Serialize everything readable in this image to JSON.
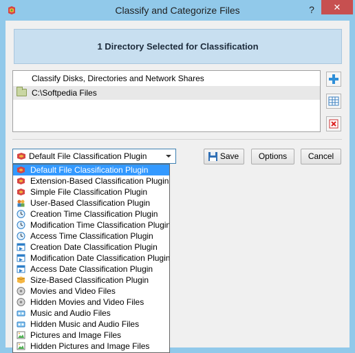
{
  "window": {
    "title": "Classify and Categorize Files",
    "help_label": "?",
    "close_label": "✕"
  },
  "header_panel": {
    "text": "1 Directory Selected for Classification"
  },
  "directory_list": {
    "header": "Classify Disks, Directories and Network Shares",
    "items": [
      {
        "label": "C:\\Softpedia Files",
        "icon": "folder-icon"
      }
    ]
  },
  "side_buttons": [
    {
      "name": "add-directory-button",
      "icon": "plus-icon"
    },
    {
      "name": "select-directory-button",
      "icon": "grid-icon"
    },
    {
      "name": "remove-directory-button",
      "icon": "remove-icon"
    }
  ],
  "plugin_select": {
    "selected": "Default File Classification Plugin",
    "options": [
      {
        "label": "Default File Classification Plugin",
        "icon": "plugin-icon"
      },
      {
        "label": "Extension-Based Classification Plugin",
        "icon": "plugin-icon"
      },
      {
        "label": "Simple File Classification Plugin",
        "icon": "plugin-icon"
      },
      {
        "label": "User-Based Classification Plugin",
        "icon": "user-icon"
      },
      {
        "label": "Creation Time Classification Plugin",
        "icon": "clock-icon"
      },
      {
        "label": "Modification Time Classification Plugin",
        "icon": "clock-icon"
      },
      {
        "label": "Access Time Classification Plugin",
        "icon": "clock-icon"
      },
      {
        "label": "Creation Date Classification Plugin",
        "icon": "calendar-icon"
      },
      {
        "label": "Modification Date Classification Plugin",
        "icon": "calendar-icon"
      },
      {
        "label": "Access Date Classification Plugin",
        "icon": "calendar-icon"
      },
      {
        "label": "Size-Based Classification Plugin",
        "icon": "box-icon"
      },
      {
        "label": "Movies and Video Files",
        "icon": "video-icon"
      },
      {
        "label": "Hidden Movies and Video Files",
        "icon": "video-icon"
      },
      {
        "label": "Music and Audio Files",
        "icon": "audio-icon"
      },
      {
        "label": "Hidden Music and Audio Files",
        "icon": "audio-icon"
      },
      {
        "label": "Pictures and Image Files",
        "icon": "picture-icon"
      },
      {
        "label": "Hidden Pictures and Image Files",
        "icon": "picture-icon"
      }
    ]
  },
  "buttons": {
    "save": "Save",
    "options": "Options",
    "cancel": "Cancel"
  },
  "colors": {
    "titlebar": "#91c9ea",
    "close": "#c75050",
    "selection": "#3399ff",
    "header_panel": "#c8dff0"
  }
}
